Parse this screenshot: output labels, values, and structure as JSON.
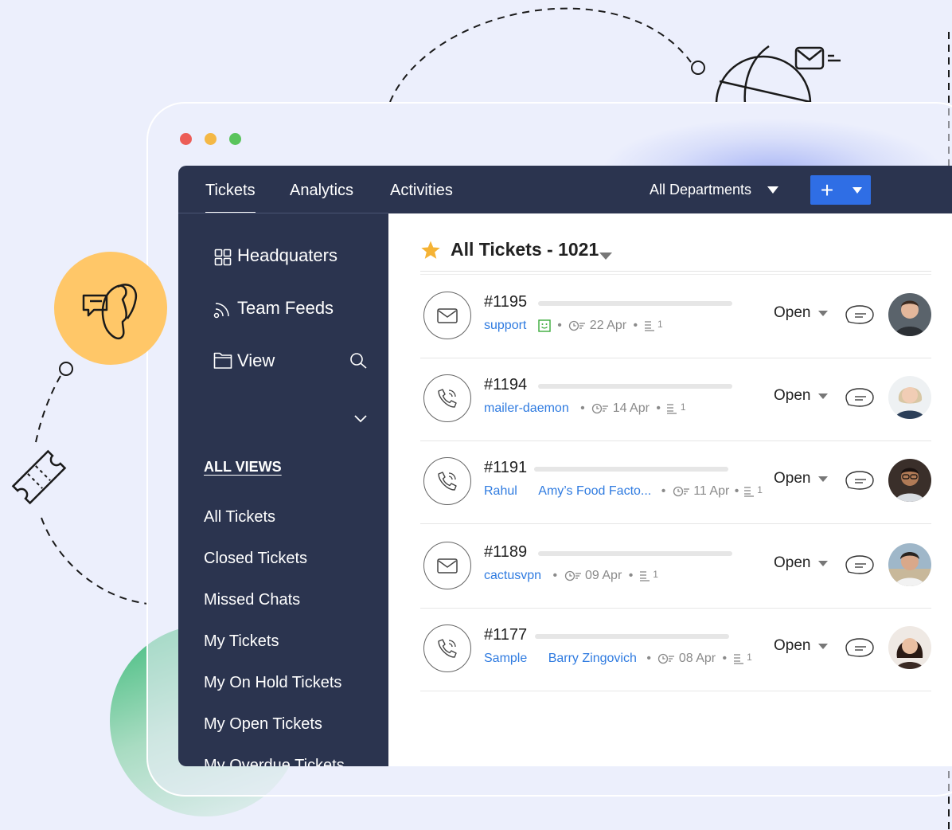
{
  "window": {
    "controls": [
      "close",
      "minimize",
      "maximize"
    ]
  },
  "topbar": {
    "tabs": [
      {
        "label": "Tickets",
        "active": true
      },
      {
        "label": "Analytics",
        "active": false
      },
      {
        "label": "Activities",
        "active": false
      }
    ],
    "department": "All Departments",
    "add_button": "+"
  },
  "sidebar": {
    "links": [
      {
        "label": "Headquaters",
        "icon": "grid-icon"
      },
      {
        "label": "Team Feeds",
        "icon": "feed-icon"
      },
      {
        "label": "View",
        "icon": "folder-icon"
      }
    ],
    "all_views_label": "ALL VIEWS",
    "views": [
      "All Tickets",
      "Closed Tickets",
      "Missed Chats",
      "My Tickets",
      "My On Hold Tickets",
      "My Open Tickets",
      "My Overdue Tickets"
    ]
  },
  "main": {
    "title": "All Tickets - 1021",
    "tickets": [
      {
        "id": "#1195",
        "channel": "email-icon",
        "contact": "support",
        "account": "",
        "date": "22 Apr",
        "status": "Open",
        "happy_icon": true,
        "threads": "1"
      },
      {
        "id": "#1194",
        "channel": "phone-icon",
        "contact": "mailer-daemon",
        "account": "",
        "date": "14 Apr",
        "status": "Open",
        "happy_icon": false,
        "threads": "1"
      },
      {
        "id": "#1191",
        "channel": "phone-icon",
        "contact": "Rahul",
        "account": "Amy’s Food Facto...",
        "date": "11 Apr",
        "status": "Open",
        "happy_icon": false,
        "threads": "1"
      },
      {
        "id": "#1189",
        "channel": "email-icon",
        "contact": "cactusvpn",
        "account": "",
        "date": "09 Apr",
        "status": "Open",
        "happy_icon": false,
        "threads": "1"
      },
      {
        "id": "#1177",
        "channel": "phone-icon",
        "contact": "Sample",
        "account": "Barry Zingovich",
        "date": "08 Apr",
        "status": "Open",
        "happy_icon": false,
        "threads": "1"
      }
    ]
  },
  "colors": {
    "nav_bg": "#2b344f",
    "accent_blue": "#2f6ee5",
    "link_blue": "#2f7be0",
    "star": "#f5b335",
    "phone_bubble": "#ffc768"
  }
}
